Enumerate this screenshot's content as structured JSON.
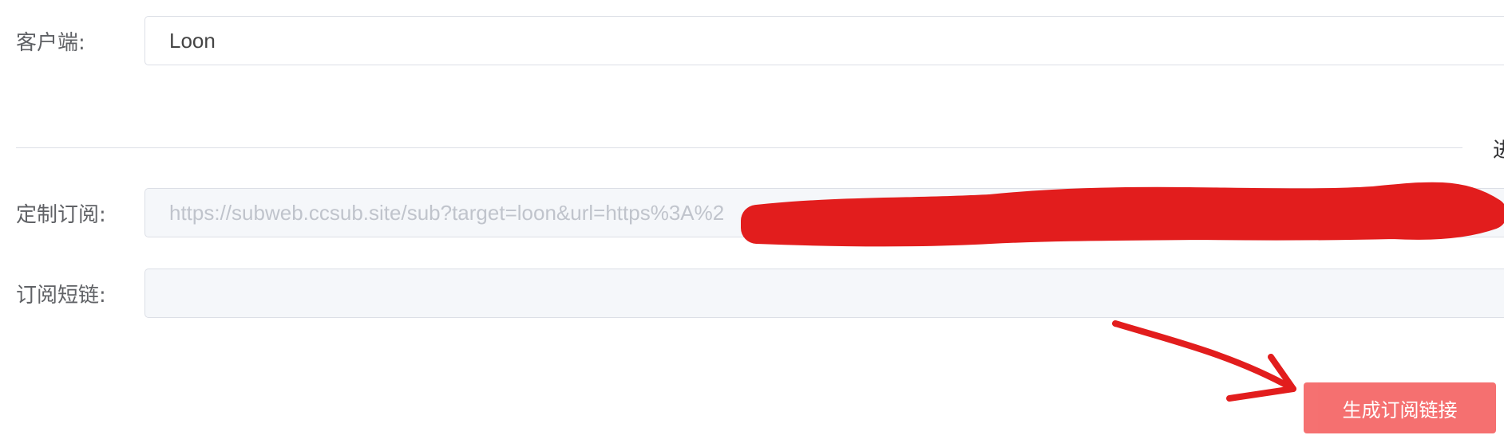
{
  "form": {
    "client": {
      "label": "客户端:",
      "value": "Loon"
    },
    "divider_tail_text": "进",
    "custom_sub": {
      "label": "定制订阅:",
      "value": "https://subweb.ccsub.site/sub?target=loon&url=https%3A%2"
    },
    "short_link": {
      "label": "订阅短链:",
      "value": ""
    },
    "generate_button": {
      "label": "生成订阅链接"
    }
  },
  "colors": {
    "primary_button": "#f56c6c",
    "annotation_red": "#e21d1d",
    "input_border": "#dcdfe6",
    "disabled_bg": "#f5f7fa"
  }
}
